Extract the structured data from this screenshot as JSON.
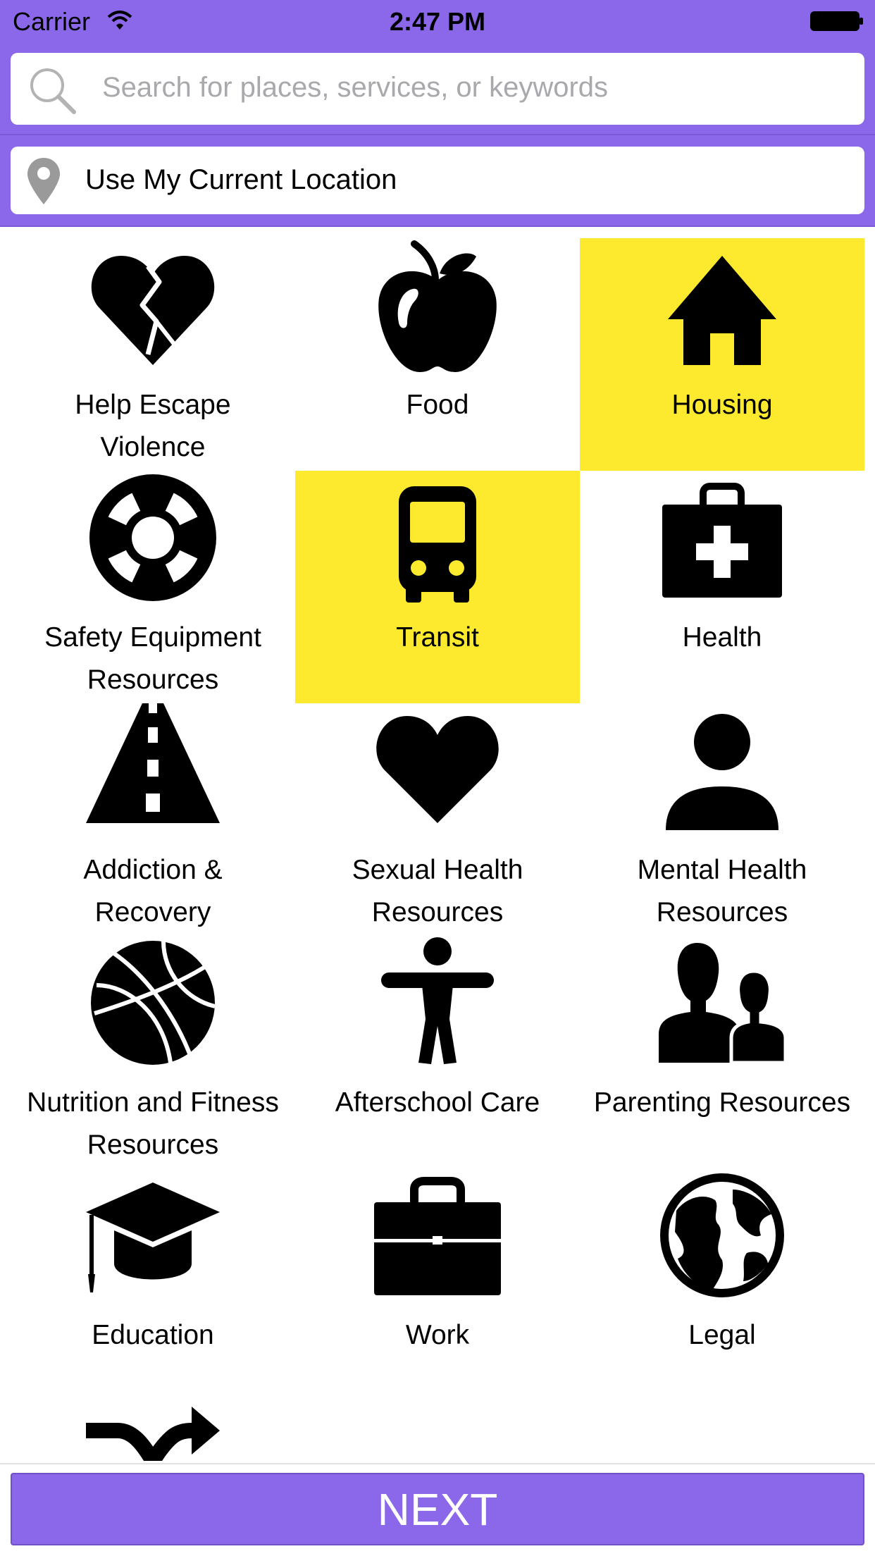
{
  "status_bar": {
    "carrier": "Carrier",
    "time": "2:47 PM"
  },
  "search": {
    "placeholder": "Search for places, services, or keywords"
  },
  "location": {
    "label": "Use My Current Location"
  },
  "categories": [
    {
      "label": "Help Escape\nViolence",
      "icon": "broken-heart-icon",
      "selected": false
    },
    {
      "label": "Food",
      "icon": "apple-icon",
      "selected": false
    },
    {
      "label": "Housing",
      "icon": "house-icon",
      "selected": true
    },
    {
      "label": "Safety Equipment\nResources",
      "icon": "life-ring-icon",
      "selected": false
    },
    {
      "label": "Transit",
      "icon": "bus-icon",
      "selected": true
    },
    {
      "label": "Health",
      "icon": "first-aid-kit-icon",
      "selected": false
    },
    {
      "label": "Addiction &\nRecovery",
      "icon": "road-icon",
      "selected": false
    },
    {
      "label": "Sexual Health\nResources",
      "icon": "heart-icon",
      "selected": false
    },
    {
      "label": "Mental Health\nResources",
      "icon": "person-icon",
      "selected": false
    },
    {
      "label": "Nutrition and Fitness\nResources",
      "icon": "basketball-icon",
      "selected": false
    },
    {
      "label": "Afterschool Care",
      "icon": "child-figure-icon",
      "selected": false
    },
    {
      "label": "Parenting Resources",
      "icon": "parent-child-icon",
      "selected": false
    },
    {
      "label": "Education",
      "icon": "graduation-cap-icon",
      "selected": false
    },
    {
      "label": "Work",
      "icon": "briefcase-icon",
      "selected": false
    },
    {
      "label": "Legal",
      "icon": "globe-icon",
      "selected": false
    },
    {
      "label": "",
      "icon": "shuffle-icon",
      "selected": false
    }
  ],
  "colors": {
    "header": "#8b68ea",
    "selected_tile": "#fdea2e",
    "button": "#8b68ea"
  },
  "next_button": {
    "label": "NEXT"
  }
}
